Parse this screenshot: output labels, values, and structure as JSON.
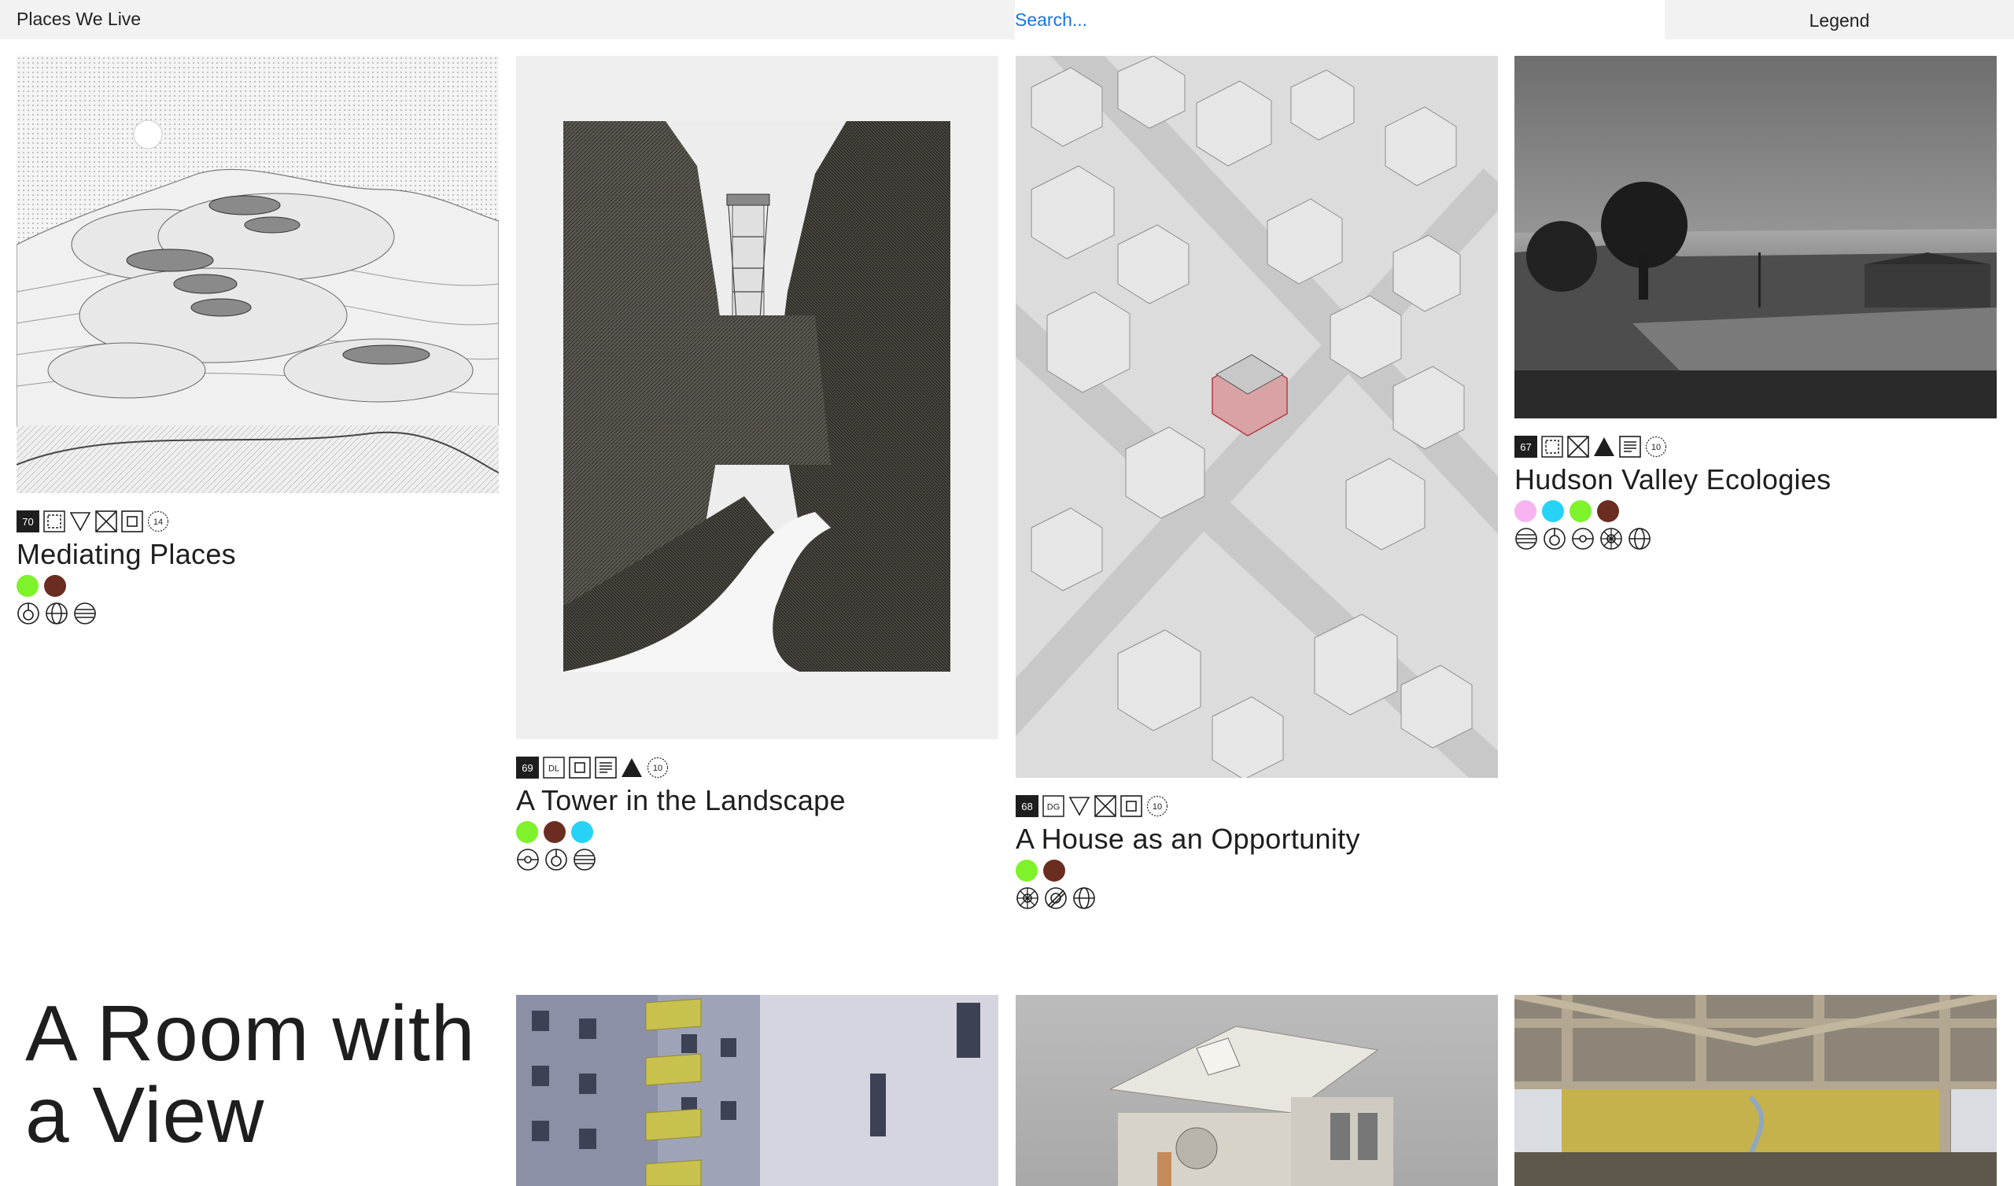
{
  "header": {
    "site_title": "Places We Live",
    "search_placeholder": "Search...",
    "legend_label": "Legend"
  },
  "colors": {
    "green": "#7ef22a",
    "brown": "#6b2d1f",
    "cyan": "#26d3f7",
    "pink": "#f8b4f0",
    "link_blue": "#1a73e8"
  },
  "projects": [
    {
      "number": "70",
      "title": "Mediating Places",
      "tag_icons": [
        "dashed-square-icon",
        "triangle-down-icon",
        "crossed-square-icon",
        "nested-square-icon"
      ],
      "count": "14",
      "color_dots": [
        "green",
        "brown"
      ],
      "category_icons": [
        "target-icon",
        "globe-icon",
        "striped-circle-icon"
      ]
    },
    {
      "number": "69",
      "code": "DL",
      "title": "A Tower in the Landscape",
      "tag_icons": [
        "nested-square-icon",
        "text-lines-icon",
        "triangle-filled-icon"
      ],
      "count": "10",
      "color_dots": [
        "green",
        "brown",
        "cyan"
      ],
      "category_icons": [
        "eye-circle-icon",
        "target-icon",
        "striped-circle-icon"
      ]
    },
    {
      "number": "68",
      "code": "DG",
      "title": "A House as an Opportunity",
      "tag_icons": [
        "triangle-down-icon",
        "crossed-square-icon",
        "nested-square-icon"
      ],
      "count": "10",
      "color_dots": [
        "green",
        "brown"
      ],
      "category_icons": [
        "sun-circle-icon",
        "slashed-circle-icon",
        "globe-icon"
      ]
    },
    {
      "number": "67",
      "title": "Hudson Valley Ecologies",
      "tag_icons": [
        "dashed-square-icon",
        "crossed-square-icon",
        "triangle-filled-icon",
        "text-lines-icon"
      ],
      "count": "10",
      "color_dots": [
        "pink",
        "cyan",
        "green",
        "brown"
      ],
      "category_icons": [
        "striped-circle-icon",
        "target-icon",
        "eye-circle-icon",
        "sun-circle-icon",
        "globe-icon"
      ]
    }
  ],
  "section": {
    "title_line1": "A Room with",
    "title_line2": "a View"
  }
}
